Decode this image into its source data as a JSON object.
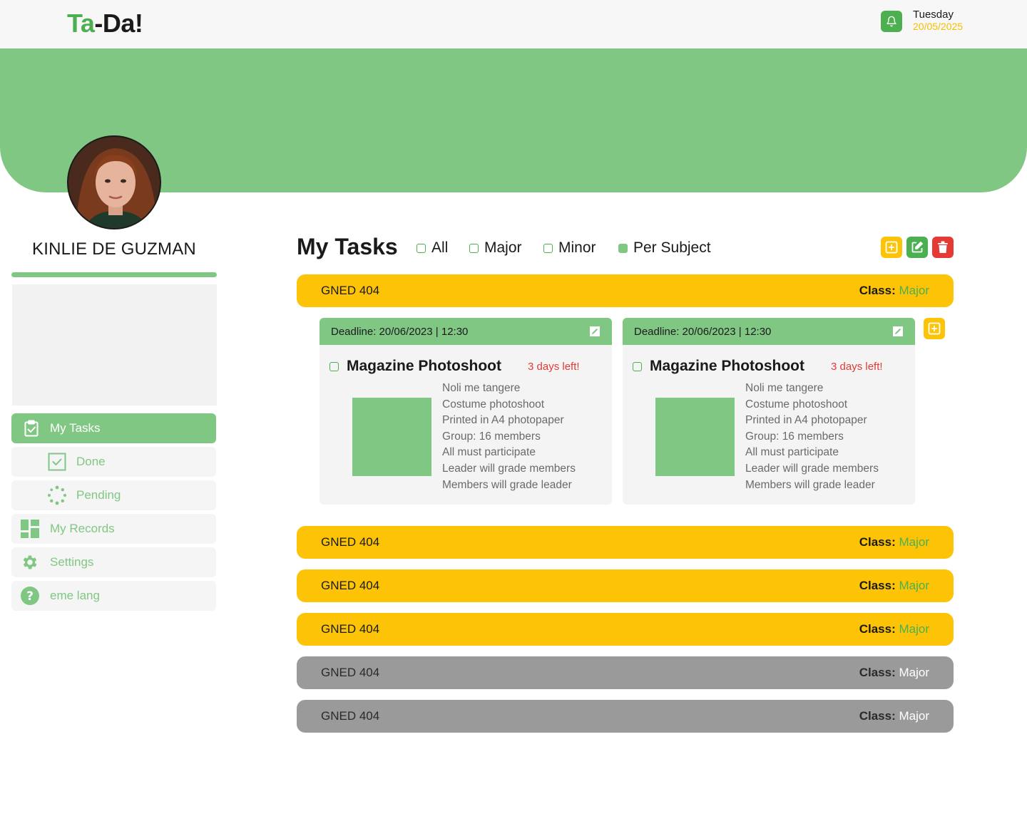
{
  "header": {
    "logo_part1": "Ta",
    "logo_part2": "-Da!",
    "day": "Tuesday",
    "date": "20/05/2025",
    "notification_icon": "bell-icon"
  },
  "profile": {
    "name": "KINLIE DE GUZMAN"
  },
  "sidebar": {
    "items": [
      {
        "label": "My Tasks",
        "icon": "clipboard-check-icon",
        "active": true
      },
      {
        "label": "Done",
        "icon": "checkbox-icon"
      },
      {
        "label": "Pending",
        "icon": "spinner-icon"
      },
      {
        "label": "My Records",
        "icon": "dashboard-icon"
      },
      {
        "label": "Settings",
        "icon": "gear-icon"
      },
      {
        "label": "eme lang",
        "icon": "help-icon"
      }
    ]
  },
  "tasks": {
    "title": "My Tasks",
    "filters": [
      {
        "label": "All",
        "checked": false
      },
      {
        "label": "Major",
        "checked": false
      },
      {
        "label": "Minor",
        "checked": false
      },
      {
        "label": "Per Subject",
        "checked": true
      }
    ],
    "class_label": "Class:",
    "subjects": [
      {
        "code": "GNED 404",
        "class": "Major",
        "color": "yellow"
      },
      {
        "code": "GNED 404",
        "class": "Major",
        "color": "yellow"
      },
      {
        "code": "GNED 404",
        "class": "Major",
        "color": "yellow"
      },
      {
        "code": "GNED 404",
        "class": "Major",
        "color": "yellow"
      },
      {
        "code": "GNED 404",
        "class": "Major",
        "color": "gray"
      },
      {
        "code": "GNED 404",
        "class": "Major",
        "color": "gray"
      }
    ],
    "cards": [
      {
        "deadline": "Deadline: 20/06/2023 | 12:30",
        "title": "Magazine Photoshoot",
        "due": "3 days left!",
        "lines": [
          "Noli me tangere",
          "Costume photoshoot",
          "Printed in A4 photopaper",
          "Group: 16 members",
          "All must participate",
          "Leader will grade members",
          "Members will grade leader"
        ]
      },
      {
        "deadline": "Deadline: 20/06/2023 | 12:30",
        "title": "Magazine Photoshoot",
        "due": "3 days left!",
        "lines": [
          "Noli me tangere",
          "Costume photoshoot",
          "Printed in A4 photopaper",
          "Group: 16 members",
          "All must participate",
          "Leader will grade members",
          "Members will grade leader"
        ]
      }
    ]
  },
  "colors": {
    "green": "#81c784",
    "dark_green": "#4caf50",
    "yellow": "#fdc407",
    "gray": "#9a9a9a",
    "red": "#e53935"
  }
}
